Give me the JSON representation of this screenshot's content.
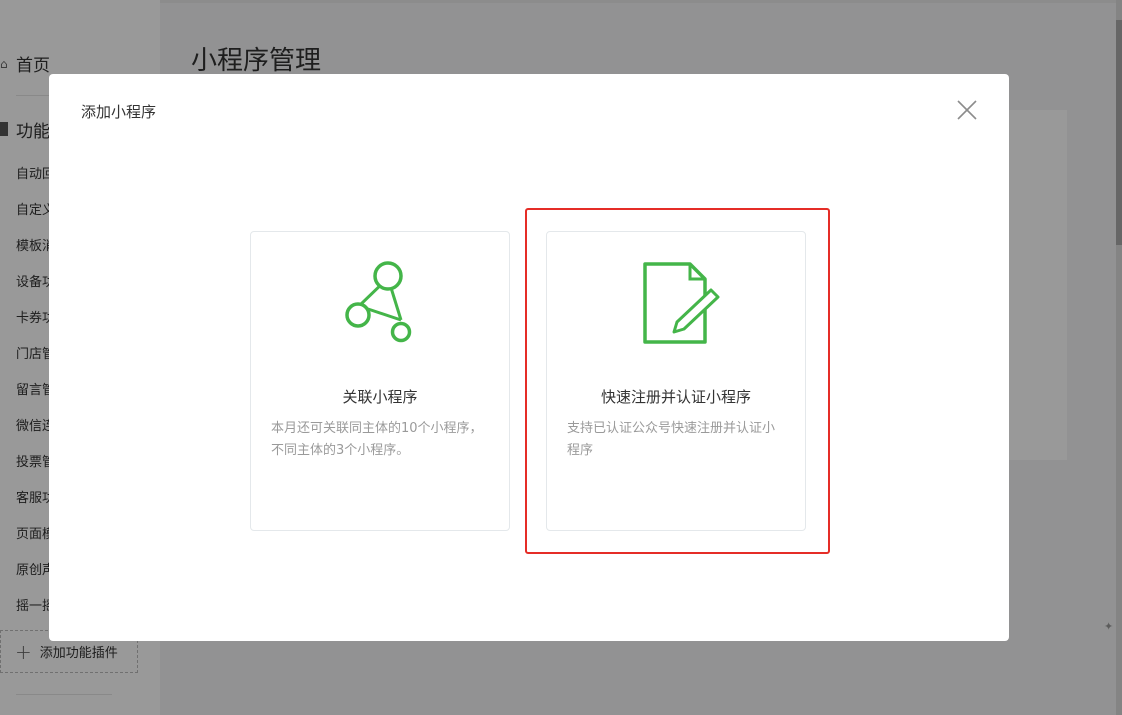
{
  "sidebar": {
    "home_label": "首页",
    "section_label": "功能",
    "items": [
      {
        "label": "自动回复"
      },
      {
        "label": "自定义菜单"
      },
      {
        "label": "模板消息"
      },
      {
        "label": "设备功能"
      },
      {
        "label": "卡券功能"
      },
      {
        "label": "门店管理"
      },
      {
        "label": "留言管理"
      },
      {
        "label": "微信连Wi-Fi"
      },
      {
        "label": "投票管理"
      },
      {
        "label": "客服功能"
      },
      {
        "label": "页面模版"
      },
      {
        "label": "原创声明"
      },
      {
        "label": "摇一摇"
      }
    ],
    "add_plugin_label": "添加功能插件"
  },
  "main": {
    "title": "小程序管理"
  },
  "modal": {
    "title": "添加小程序",
    "close_icon": "close-icon",
    "options": [
      {
        "icon": "network-link-icon",
        "title": "关联小程序",
        "description": "本月还可关联同主体的10个小程序，不同主体的3个小程序。"
      },
      {
        "icon": "document-edit-icon",
        "title": "快速注册并认证小程序",
        "description": "支持已认证公众号快速注册并认证小程序"
      }
    ]
  },
  "colors": {
    "accent_green": "#44b549",
    "highlight_red": "#e52d27",
    "overlay": "rgba(0,0,0,0.4)"
  }
}
